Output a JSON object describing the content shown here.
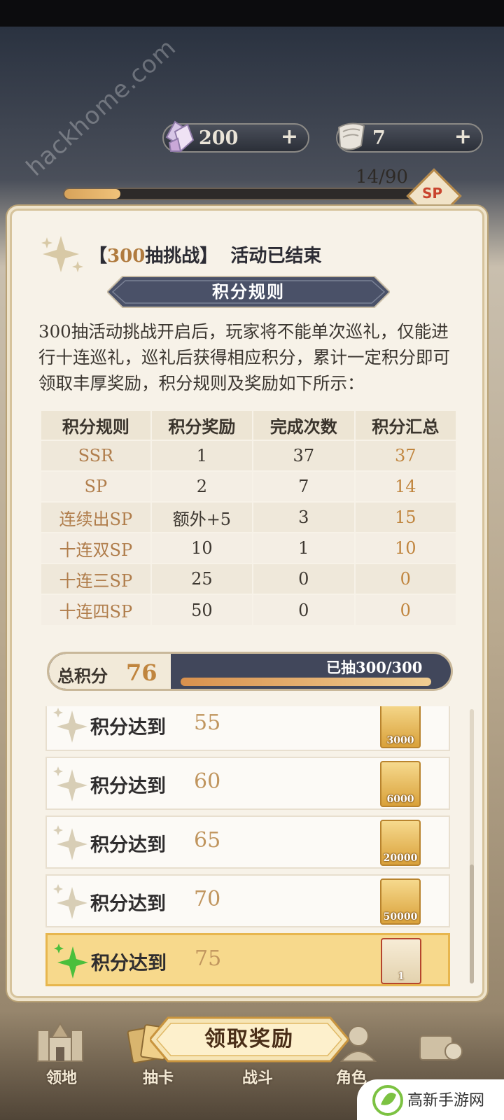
{
  "watermark": "hackhome.com",
  "currency": [
    {
      "icon": "crystal-icon",
      "value": "200",
      "plus": "+"
    },
    {
      "icon": "scroll-icon",
      "value": "7",
      "plus": "+"
    }
  ],
  "pity": {
    "text": "14/90",
    "fraction": 0.156,
    "badge": "SP"
  },
  "dialog": {
    "title_bracket_open": "【",
    "title_highlight": "300",
    "title_rest": "抽挑战】",
    "title_status": "活动已结束",
    "ribbon": "积分规则",
    "intro": "300抽活动挑战开启后，玩家将不能单次巡礼，仅能进行十连巡礼，巡礼后获得相应积分，累计一定积分即可领取丰厚奖励，积分规则及奖励如下所示：",
    "table": {
      "headers": [
        "积分规则",
        "积分奖励",
        "完成次数",
        "积分汇总"
      ],
      "rows": [
        [
          "SSR",
          "1",
          "37",
          "37"
        ],
        [
          "SP",
          "2",
          "7",
          "14"
        ],
        [
          "连续出SP",
          "额外+5",
          "3",
          "15"
        ],
        [
          "十连双SP",
          "10",
          "1",
          "10"
        ],
        [
          "十连三SP",
          "25",
          "0",
          "0"
        ],
        [
          "十连四SP",
          "50",
          "0",
          "0"
        ]
      ]
    },
    "total": {
      "label": "总积分",
      "value": "76",
      "drawn_text": "已抽300/300",
      "drawn_fraction": 1.0
    },
    "rewards": [
      {
        "label": "积分达到",
        "points": "55",
        "ticket": "3000",
        "active": false
      },
      {
        "label": "积分达到",
        "points": "60",
        "ticket": "6000",
        "active": false
      },
      {
        "label": "积分达到",
        "points": "65",
        "ticket": "20000",
        "active": false
      },
      {
        "label": "积分达到",
        "points": "70",
        "ticket": "50000",
        "active": false
      },
      {
        "label": "积分达到",
        "points": "75",
        "ticket": "1",
        "active": true
      }
    ]
  },
  "claim_button": "领取奖励",
  "nav": [
    "领地",
    "抽卡",
    "战斗",
    "角色"
  ],
  "site_logo": "高新手游网",
  "colors": {
    "accent": "#c0853e",
    "active_row": "#f7d98c",
    "dark_bar": "#41475b"
  }
}
